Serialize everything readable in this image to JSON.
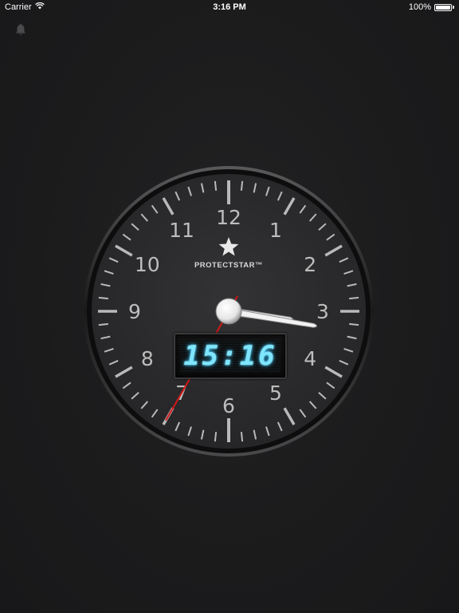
{
  "status_bar": {
    "carrier": "Carrier",
    "time": "3:16 PM",
    "battery": "100%",
    "battery_level": 1.0
  },
  "toolbar": {
    "alarm_icon": "bell-icon"
  },
  "clock": {
    "brand": "PROTECTSTAR™",
    "brand_icon": "star-logo-icon",
    "numerals": [
      "12",
      "1",
      "2",
      "3",
      "4",
      "5",
      "6",
      "7",
      "8",
      "9",
      "10",
      "11"
    ],
    "digital_time": "15:16",
    "time": {
      "hours": 15,
      "minutes": 16,
      "seconds": 35
    },
    "colors": {
      "face": "#2b2b2d",
      "bezel": "#0c0c0d",
      "tick": "#b9b9b9",
      "numeral": "#bdbdbd",
      "second_hand": "#d01818",
      "digital": "#7fe6ff"
    }
  }
}
